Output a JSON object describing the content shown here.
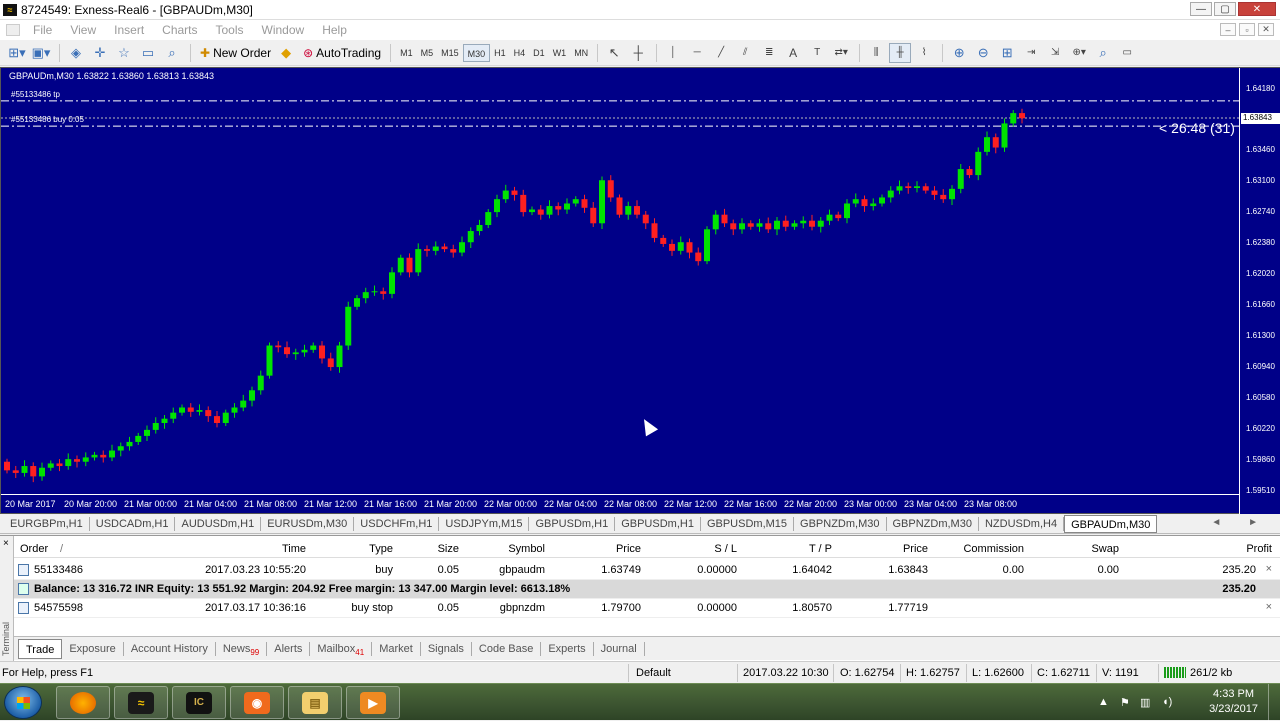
{
  "window": {
    "title": "8724549: Exness-Real6 - [GBPAUDm,M30]",
    "app_logo": "MT4",
    "controls": [
      "—",
      "▢",
      "✕"
    ]
  },
  "menu": {
    "items": [
      "File",
      "View",
      "Insert",
      "Charts",
      "Tools",
      "Window",
      "Help"
    ],
    "mdi_controls": [
      "–",
      "▫",
      "✕"
    ]
  },
  "toolbar": {
    "new_order": "New Order",
    "autotrading": "AutoTrading",
    "timeframes": [
      "M1",
      "M5",
      "M15",
      "M30",
      "H1",
      "H4",
      "D1",
      "W1",
      "MN"
    ],
    "active_timeframe": "M30"
  },
  "chart": {
    "header": "GBPAUDm,M30  1.63822 1.63860 1.63813 1.63843",
    "tp_label": "#55133486 tp",
    "buy_label": "#55133486 buy 0.05",
    "timer": "< 26:48 (31)",
    "current_price": "1.63843",
    "price_labels": [
      "1.64180",
      "1.63460",
      "1.63100",
      "1.62740",
      "1.62380",
      "1.62020",
      "1.61660",
      "1.61300",
      "1.60940",
      "1.60580",
      "1.60220",
      "1.59860",
      "1.59510"
    ],
    "time_labels": [
      "20 Mar 2017",
      "20 Mar 20:00",
      "21 Mar 00:00",
      "21 Mar 04:00",
      "21 Mar 08:00",
      "21 Mar 12:00",
      "21 Mar 16:00",
      "21 Mar 20:00",
      "22 Mar 00:00",
      "22 Mar 04:00",
      "22 Mar 08:00",
      "22 Mar 12:00",
      "22 Mar 16:00",
      "22 Mar 20:00",
      "23 Mar 00:00",
      "23 Mar 04:00",
      "23 Mar 08:00"
    ],
    "colors": {
      "background": "#000088",
      "bull": "#00e400",
      "bear": "#ff2020",
      "grid_lines": "#ffffff"
    },
    "closes": [
      1.5975,
      1.5972,
      1.598,
      1.5968,
      1.5978,
      1.5983,
      1.598,
      1.5988,
      1.5985,
      1.599,
      1.5993,
      1.599,
      1.5998,
      1.6003,
      1.6008,
      1.6015,
      1.6022,
      1.603,
      1.6035,
      1.6042,
      1.6048,
      1.6043,
      1.6045,
      1.6038,
      1.603,
      1.6042,
      1.6048,
      1.6056,
      1.6068,
      1.6085,
      1.612,
      1.6118,
      1.611,
      1.6112,
      1.6115,
      1.612,
      1.6105,
      1.6095,
      1.612,
      1.6165,
      1.6175,
      1.6182,
      1.6183,
      1.618,
      1.6205,
      1.6222,
      1.6205,
      1.6232,
      1.623,
      1.6235,
      1.6232,
      1.6228,
      1.624,
      1.6253,
      1.626,
      1.6275,
      1.629,
      1.63,
      1.6295,
      1.6275,
      1.6278,
      1.6272,
      1.6282,
      1.6278,
      1.6285,
      1.629,
      1.628,
      1.6262,
      1.6312,
      1.6292,
      1.6272,
      1.6282,
      1.6272,
      1.6262,
      1.6245,
      1.6238,
      1.623,
      1.624,
      1.6228,
      1.6218,
      1.6255,
      1.6272,
      1.6262,
      1.6255,
      1.6262,
      1.6258,
      1.6262,
      1.6255,
      1.6265,
      1.6258,
      1.6262,
      1.6265,
      1.6258,
      1.6265,
      1.6272,
      1.6268,
      1.6285,
      1.629,
      1.6282,
      1.6285,
      1.6292,
      1.63,
      1.6305,
      1.6303,
      1.6305,
      1.63,
      1.6295,
      1.629,
      1.6302,
      1.6325,
      1.6318,
      1.6345,
      1.6362,
      1.635,
      1.6378,
      1.639,
      1.6384
    ]
  },
  "symbol_tabs": {
    "items": [
      "EURGBPm,H1",
      "USDCADm,H1",
      "AUDUSDm,H1",
      "EURUSDm,M30",
      "USDCHFm,H1",
      "USDJPYm,M15",
      "GBPUSDm,H1",
      "GBPUSDm,H1",
      "GBPUSDm,M15",
      "GBPNZDm,M30",
      "GBPNZDm,M30",
      "NZDUSDm,H4",
      "GBPAUDm,M30"
    ],
    "active": "GBPAUDm,M30",
    "nav": "◄ ►"
  },
  "terminal": {
    "side_label": "Terminal",
    "close": "×",
    "headers": {
      "order": "Order",
      "sort": "/",
      "time": "Time",
      "type": "Type",
      "size": "Size",
      "symbol": "Symbol",
      "price": "Price",
      "sl": "S / L",
      "tp": "T / P",
      "price2": "Price",
      "commission": "Commission",
      "swap": "Swap",
      "profit": "Profit"
    },
    "trade": {
      "order": "55133486",
      "time": "2017.03.23 10:55:20",
      "type": "buy",
      "size": "0.05",
      "symbol": "gbpaudm",
      "price": "1.63749",
      "sl": "0.00000",
      "tp": "1.64042",
      "price2": "1.63843",
      "commission": "0.00",
      "swap": "0.00",
      "profit": "235.20"
    },
    "balance": {
      "text": "Balance: 13 316.72 INR  Equity: 13 551.92  Margin: 204.92  Free margin: 13 347.00  Margin level: 6613.18%",
      "profit": "235.20"
    },
    "pending": {
      "order": "54575598",
      "time": "2017.03.17 10:36:16",
      "type": "buy stop",
      "size": "0.05",
      "symbol": "gbpnzdm",
      "price": "1.79700",
      "sl": "0.00000",
      "tp": "1.80570",
      "price2": "1.77719"
    },
    "row_close": "×"
  },
  "bottom_tabs": {
    "items": [
      "Trade",
      "Exposure",
      "Account History",
      "News",
      "Alerts",
      "Mailbox",
      "Market",
      "Signals",
      "Code Base",
      "Experts",
      "Journal"
    ],
    "news_count": "99",
    "mailbox_count": "41",
    "active": "Trade"
  },
  "statusbar": {
    "help": "For Help, press F1",
    "profile": "Default",
    "datetime": "2017.03.22 10:30",
    "open": "O: 1.62754",
    "high": "H: 1.62757",
    "low": "L: 1.62600",
    "close": "C: 1.62711",
    "volume": "V: 1191",
    "traffic": "261/2 kb"
  },
  "taskbar": {
    "clock_time": "4:33 PM",
    "clock_date": "3/23/2017",
    "apps": [
      "firefox",
      "metatrader",
      "ic-markets",
      "screen-recorder",
      "file-explorer",
      "media-player"
    ]
  }
}
